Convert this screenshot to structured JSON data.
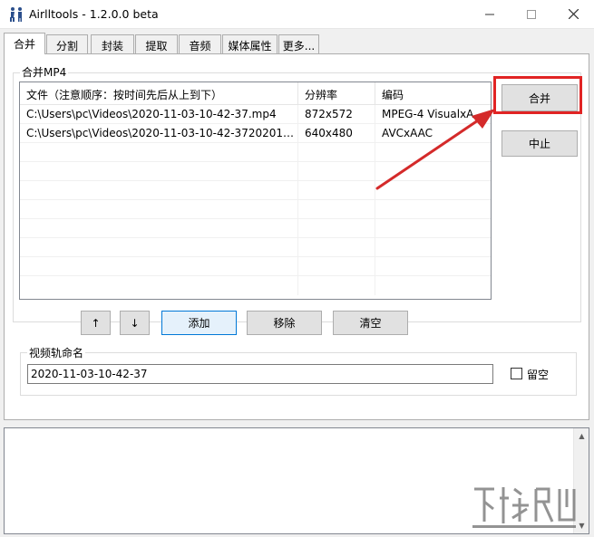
{
  "window": {
    "title": "Airlltools   -   1.2.0.0 beta",
    "min_icon": "minimize-icon",
    "max_icon": "maximize-icon",
    "close_icon": "close-icon"
  },
  "tabs": [
    {
      "label": "合并",
      "active": true
    },
    {
      "label": "分割"
    },
    {
      "label": "封装"
    },
    {
      "label": "提取"
    },
    {
      "label": "音频"
    },
    {
      "label": "媒体属性"
    },
    {
      "label": "更多..."
    }
  ],
  "merge_group": {
    "label": "合并MP4",
    "list": {
      "columns": [
        "文件（注意顺序：按时间先后从上到下）",
        "分辨率",
        "编码"
      ],
      "rows": [
        [
          "C:\\Users\\pc\\Videos\\2020-11-03-10-42-37.mp4",
          "872x572",
          "MPEG-4 VisualxA..."
        ],
        [
          "C:\\Users\\pc\\Videos\\2020-11-03-10-42-37202012...",
          "640x480",
          "AVCxAAC"
        ]
      ]
    },
    "buttons": {
      "merge": "合并",
      "stop": "中止",
      "up": "↑",
      "down": "↓",
      "add": "添加",
      "remove": "移除",
      "clear": "清空"
    }
  },
  "track_group": {
    "label": "视频轨命名",
    "value": "2020-11-03-10-42-37",
    "checkbox_label": "留空",
    "checkbox_checked": false
  },
  "colors": {
    "highlight_frame": "#e12424",
    "arrow": "#d42a2a",
    "accent": "#0078d7"
  }
}
